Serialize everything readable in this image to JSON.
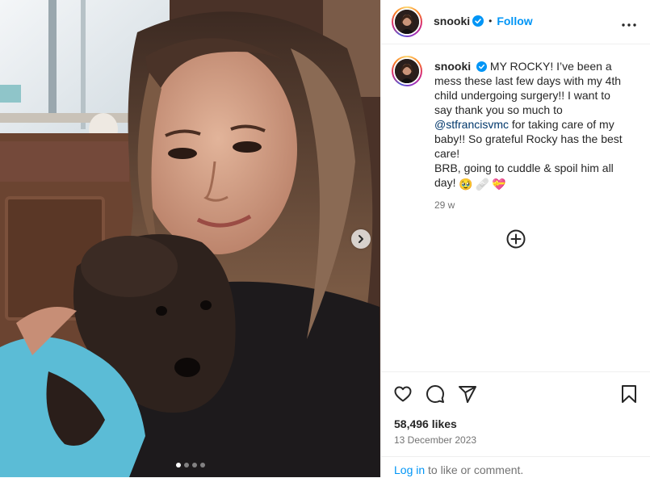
{
  "post": {
    "username": "snooki",
    "follow_label": "Follow",
    "separator": "•",
    "caption": {
      "line1": "MY ROCKY! I’ve been a mess these last few days with my 4th child undergoing surgery!! I want to say thank you so much to ",
      "mention": "@stfrancisvmc",
      "line2": " for taking care of my baby!! So grateful Rocky has the best care!",
      "line3": "BRB, going to cuddle & spoil him all day! ",
      "emojis": [
        "🥹",
        "🩹",
        "💝"
      ]
    },
    "time_ago": "29 w",
    "likes": "58,496 likes",
    "date": "13 December 2023",
    "login_link": "Log in",
    "login_suffix": " to like or comment."
  },
  "media": {
    "slide_count": 4,
    "active_slide": 1
  },
  "icons": {
    "more": "more-options-icon",
    "verified": "verified-badge-icon",
    "next": "chevron-right-icon",
    "add_comment": "plus-circle-icon",
    "like": "heart-icon",
    "comment": "comment-icon",
    "share": "share-icon",
    "save": "bookmark-icon"
  },
  "colors": {
    "accent": "#0095f6",
    "verified": "#0095f6",
    "mention": "#00376b",
    "muted": "#737373",
    "shirt": "#5bbcd6"
  }
}
